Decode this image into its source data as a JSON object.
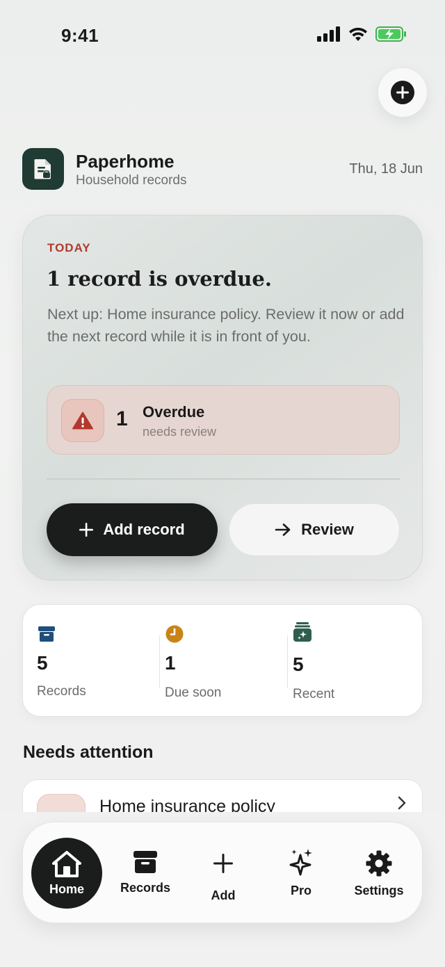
{
  "status_bar": {
    "time": "9:41"
  },
  "app": {
    "title": "Paperhome",
    "subtitle": "Household records",
    "date": "Thu, 18 Jun"
  },
  "today_card": {
    "label": "TODAY",
    "headline": "1 record is overdue.",
    "body": "Next up: Home insurance policy. Review it now or add the next record while it is in front of you.",
    "overdue": {
      "count": "1",
      "title": "Overdue",
      "subtitle": "needs review"
    },
    "add_button": {
      "label": "Add record",
      "icon": "plus-icon"
    },
    "review_button": {
      "label": "Review",
      "icon": "arrow-right-icon"
    }
  },
  "stats": [
    {
      "value": "5",
      "label": "Records",
      "icon": "archive-box-icon",
      "color": "#1f4f7a"
    },
    {
      "value": "1",
      "label": "Due soon",
      "icon": "clock-icon",
      "color": "#c98418"
    },
    {
      "value": "5",
      "label": "Recent",
      "icon": "stack-sparkle-icon",
      "color": "#2e5e4e"
    }
  ],
  "needs_attention": {
    "title": "Needs attention",
    "items": [
      {
        "title": "Home insurance policy"
      }
    ]
  },
  "tabs": [
    {
      "label": "Home",
      "icon": "house-icon",
      "active": true
    },
    {
      "label": "Records",
      "icon": "archive-icon",
      "active": false
    },
    {
      "label": "Add",
      "icon": "plus-icon",
      "active": false
    },
    {
      "label": "Pro",
      "icon": "sparkles-icon",
      "active": false
    },
    {
      "label": "Settings",
      "icon": "gear-icon",
      "active": false
    }
  ],
  "colors": {
    "accent_dark": "#1b1c1c",
    "brand_green": "#1f3b33",
    "overdue_red": "#b03a2e"
  }
}
